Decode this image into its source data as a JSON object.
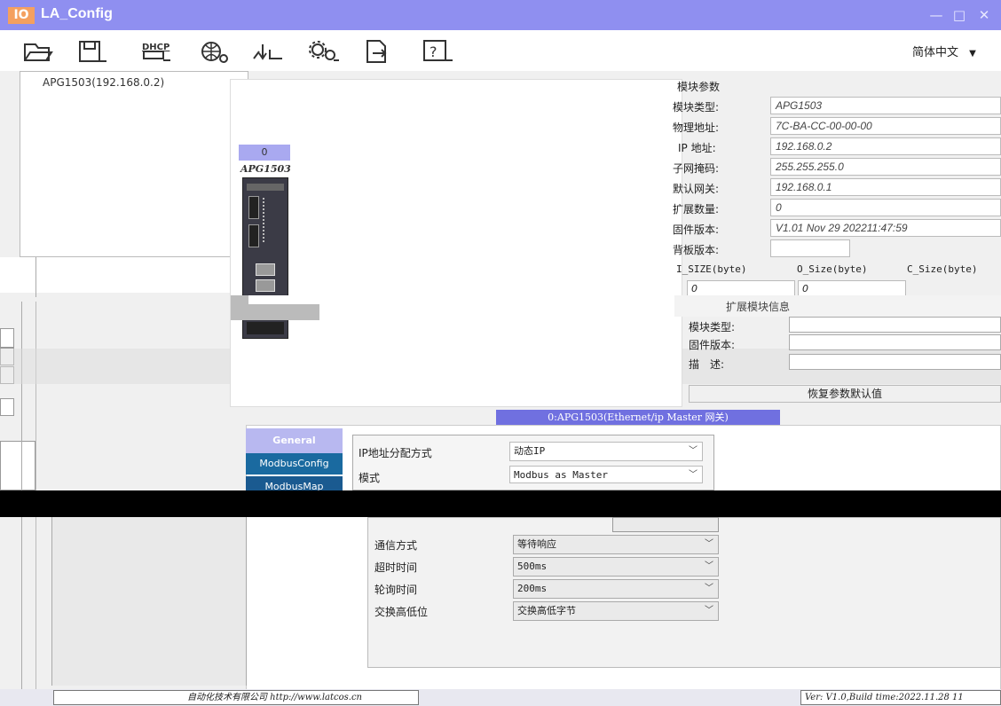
{
  "window": {
    "logo": "IO",
    "title": "LA_Config",
    "controls": {
      "minimize": "—",
      "maximize": "□",
      "close": "✕"
    }
  },
  "toolbar": {
    "tools": [
      "open-icon",
      "save-icon",
      "dhcp-icon",
      "network-scan-icon",
      "download-icon",
      "settings-icon",
      "export-icon",
      "help-icon"
    ],
    "dhcp_label": "DHCP",
    "language": "简体中文",
    "language_caret": "▼"
  },
  "tree": {
    "items": [
      {
        "label": "APG1503(192.168.0.2)"
      }
    ]
  },
  "module_view": {
    "slot": "0",
    "model": "APG1503"
  },
  "params": {
    "header": "模块参数",
    "rows": [
      {
        "label": "模块类型:",
        "value": "APG1503"
      },
      {
        "label": "物理地址:",
        "value": "7C-BA-CC-00-00-00"
      },
      {
        "label": "IP 地址:",
        "value": "192.168.0.2"
      },
      {
        "label": "子网掩码:",
        "value": "255.255.255.0"
      },
      {
        "label": "默认网关:",
        "value": "192.168.0.1"
      },
      {
        "label": "扩展数量:",
        "value": "0"
      },
      {
        "label": "固件版本:",
        "value": "V1.01 Nov 29 202211:47:59"
      },
      {
        "label": "背板版本:",
        "value": ""
      }
    ],
    "sizes": {
      "i_label": "I_SIZE(byte)",
      "o_label": "O_Size(byte)",
      "c_label": "C_Size(byte)",
      "i_value": "0",
      "o_value": "0"
    }
  },
  "ext": {
    "header": "扩展模块信息",
    "rows": [
      {
        "label": "模块类型:"
      },
      {
        "label": "固件版本:"
      },
      {
        "label": "描　述:"
      }
    ],
    "restore_label": "恢复参数默认值"
  },
  "module_tab": "0:APG1503(Ethernet/ip Master 网关)",
  "config": {
    "tabs": [
      "General",
      "ModbusConfig",
      "ModbusMap"
    ],
    "rows": [
      {
        "label": "IP地址分配方式",
        "value": "动态IP"
      },
      {
        "label": "模式",
        "value": "Modbus as Master"
      }
    ],
    "lower_rows": [
      {
        "label": "通信方式",
        "value": "等待响应"
      },
      {
        "label": "超时时间",
        "value": "500ms"
      },
      {
        "label": "轮询时间",
        "value": "200ms"
      },
      {
        "label": "交换高低位",
        "value": "交换高低字节"
      }
    ]
  },
  "status": {
    "company": "自动化技术有限公司 http://www.latcos.cn",
    "version": "Ver: V1.0,Build time:2022.11.28 11"
  }
}
